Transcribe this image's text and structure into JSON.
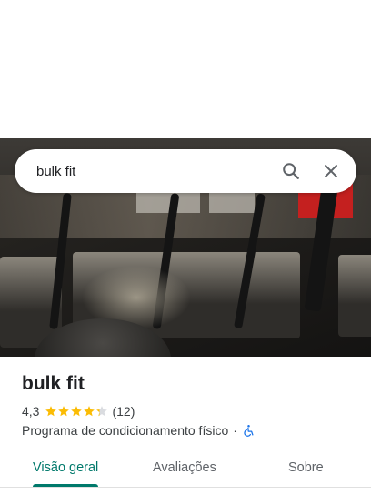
{
  "search": {
    "query": "bulk fit"
  },
  "icons": {
    "search": "search-icon",
    "close": "close-icon",
    "accessibility": "wheelchair-icon",
    "star": "star-icon"
  },
  "place": {
    "name": "bulk fit",
    "rating_text": "4,3",
    "rating_value": 4.3,
    "stars_max": 5,
    "review_count": "(12)",
    "category": "Programa de condicionamento físico",
    "separator": "·"
  },
  "tabs": [
    {
      "label": "Visão geral",
      "active": true
    },
    {
      "label": "Avaliações",
      "active": false
    },
    {
      "label": "Sobre",
      "active": false
    }
  ],
  "colors": {
    "accent": "#00796b",
    "star": "#fbbc04",
    "accessibility": "#1a73e8"
  }
}
